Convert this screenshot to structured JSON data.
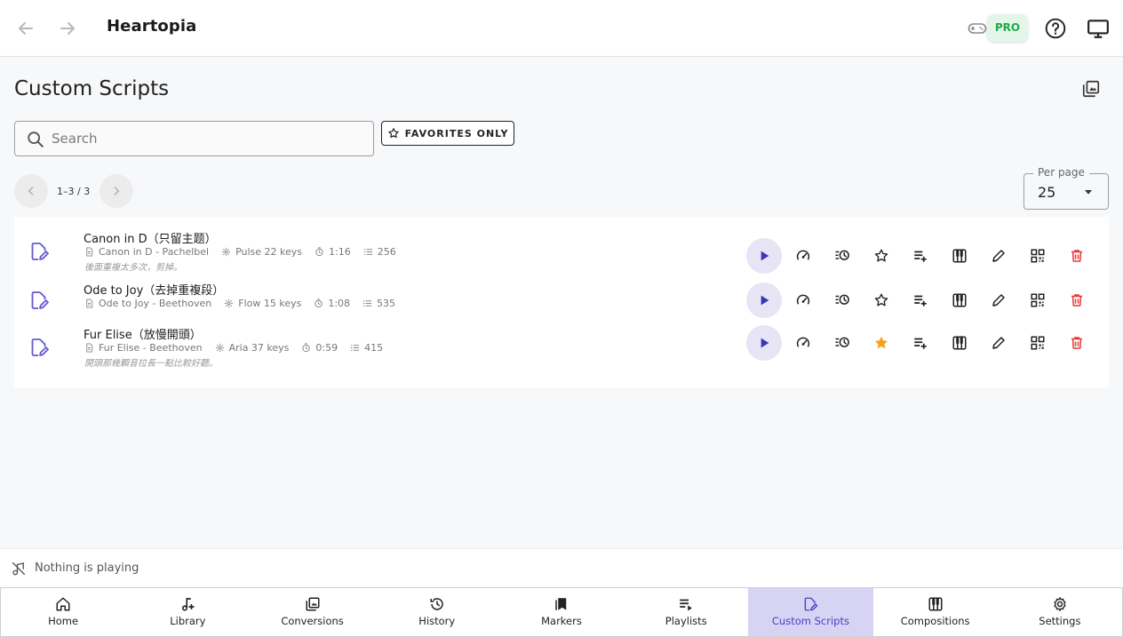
{
  "app": {
    "title": "Heartopia",
    "pro_label": "PRO"
  },
  "page": {
    "title": "Custom Scripts"
  },
  "search": {
    "placeholder": "Search",
    "value": ""
  },
  "filters": {
    "favorites_only_label": "FAVORITES ONLY"
  },
  "pagination": {
    "range": "1–3 / 3",
    "per_page_label": "Per page",
    "per_page_value": "25"
  },
  "scripts": [
    {
      "name": "Canon in D（只留主题）",
      "source": "Canon in D - Pachelbel",
      "instrument": "Pulse 22 keys",
      "duration": "1:16",
      "notes": "256",
      "comment": "後面重複太多次，剪掉。",
      "favorite": false
    },
    {
      "name": "Ode to Joy（去掉重複段）",
      "source": "Ode to Joy - Beethoven",
      "instrument": "Flow 15 keys",
      "duration": "1:08",
      "notes": "535",
      "comment": "",
      "favorite": false
    },
    {
      "name": "Fur Elise（放慢開頭）",
      "source": "Fur Elise - Beethoven",
      "instrument": "Aria 37 keys",
      "duration": "0:59",
      "notes": "415",
      "comment": "開頭那幾顆音拉長一點比較好聽。",
      "favorite": true
    }
  ],
  "player": {
    "status": "Nothing is playing"
  },
  "bottom_nav": [
    {
      "label": "Home",
      "icon": "home-icon"
    },
    {
      "label": "Library",
      "icon": "music-note-add-icon"
    },
    {
      "label": "Conversions",
      "icon": "convert-icon"
    },
    {
      "label": "History",
      "icon": "history-icon"
    },
    {
      "label": "Markers",
      "icon": "bookmarks-icon"
    },
    {
      "label": "Playlists",
      "icon": "playlist-play-icon"
    },
    {
      "label": "Custom Scripts",
      "icon": "edit-document-icon",
      "active": true
    },
    {
      "label": "Compositions",
      "icon": "piano-icon"
    },
    {
      "label": "Settings",
      "icon": "gear-icon"
    }
  ],
  "colors": {
    "accent": "#4a3fc4",
    "active_nav_bg": "#d6d3f3",
    "favorite": "#f4a31a",
    "delete": "#e53935",
    "pro": "#1fa84a"
  }
}
